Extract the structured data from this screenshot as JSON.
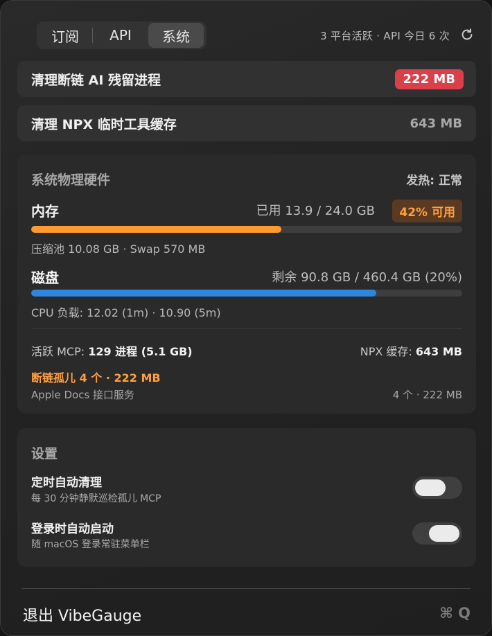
{
  "tabs": [
    {
      "label": "订阅",
      "selected": false
    },
    {
      "label": "API",
      "selected": false
    },
    {
      "label": "系统",
      "selected": true
    }
  ],
  "header_status": "3 平台活跃 · API 今日 6 次",
  "cleanup_items": [
    {
      "label": "清理断链 AI 残留进程",
      "value": "222 MB",
      "style": "danger-badge"
    },
    {
      "label": "清理 NPX 临时工具缓存",
      "value": "643 MB",
      "style": "plain"
    }
  ],
  "hardware": {
    "title": "系统物理硬件",
    "thermal": "发热: 正常",
    "memory": {
      "label": "内存",
      "usage": "已用 13.9 / 24.0 GB",
      "available_badge": "42% 可用",
      "used_fraction": 0.58,
      "detail": "压缩池 10.08 GB · Swap 570 MB",
      "bar_color": "#ff9a2e"
    },
    "disk": {
      "label": "磁盘",
      "usage": "剩余 90.8 GB / 460.4 GB (20%)",
      "used_fraction": 0.8,
      "detail": "CPU 负载: 12.02 (1m) · 10.90 (5m)",
      "bar_color": "#2f86e0"
    },
    "mcp": {
      "active_label": "活跃 MCP: ",
      "active_value": "129 进程 (5.1 GB)",
      "npx_label": "NPX 缓存: ",
      "npx_value": "643 MB",
      "orphan_text": "断链孤儿 4 个 · 222 MB",
      "service_name": "Apple Docs 接口服务",
      "service_value": "4 个 · 222 MB"
    }
  },
  "settings": {
    "title": "设置",
    "items": [
      {
        "title": "定时自动清理",
        "subtitle": "每 30 分钟静默巡检孤儿 MCP",
        "enabled": false
      },
      {
        "title": "登录时自动启动",
        "subtitle": "随 macOS 登录常驻菜单栏",
        "enabled": true
      }
    ]
  },
  "footer": {
    "quit_label": "退出 VibeGauge",
    "shortcut": "⌘ Q"
  },
  "colors": {
    "danger": "#d9404a",
    "accent_orange": "#ff9f3f",
    "disk_blue": "#2f86e0"
  }
}
